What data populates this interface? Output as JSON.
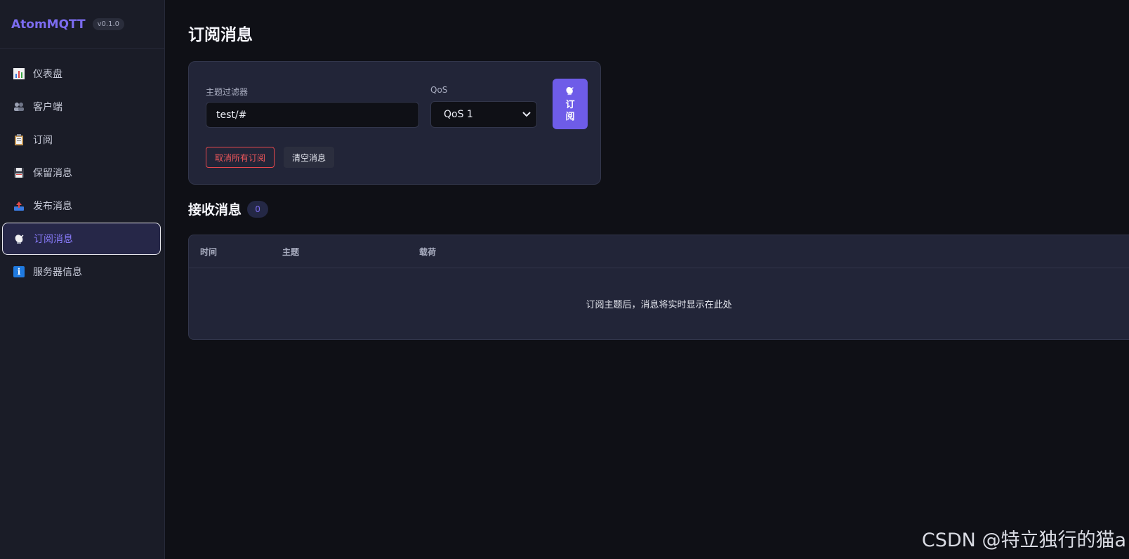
{
  "app": {
    "name": "AtomMQTT",
    "version": "v0.1.0"
  },
  "sidebar": {
    "items": [
      {
        "label": "仪表盘",
        "icon": "bar-chart-icon"
      },
      {
        "label": "客户端",
        "icon": "users-icon"
      },
      {
        "label": "订阅",
        "icon": "clipboard-icon"
      },
      {
        "label": "保留消息",
        "icon": "floppy-disk-icon"
      },
      {
        "label": "发布消息",
        "icon": "outbox-tray-icon"
      },
      {
        "label": "订阅消息",
        "icon": "satellite-dish-icon",
        "active": true
      },
      {
        "label": "服务器信息",
        "icon": "info-icon"
      }
    ]
  },
  "page": {
    "title": "订阅消息"
  },
  "form": {
    "topic_label": "主题过滤器",
    "topic_value": "test/#",
    "qos_label": "QoS",
    "qos_value": "QoS 1",
    "subscribe_label_1": "订",
    "subscribe_label_2": "阅",
    "unsubscribe_all_label": "取消所有订阅",
    "clear_messages_label": "清空消息"
  },
  "messages": {
    "title": "接收消息",
    "count": "0",
    "columns": [
      "时间",
      "主题",
      "载荷"
    ],
    "empty_text": "订阅主题后，消息将实时显示在此处"
  },
  "watermark": "CSDN @特立独行的猫a",
  "colors": {
    "accent": "#6e5ce8",
    "danger": "#e5484d",
    "background": "#0f1016",
    "sidebar": "#1a1c27",
    "card": "#222538"
  }
}
